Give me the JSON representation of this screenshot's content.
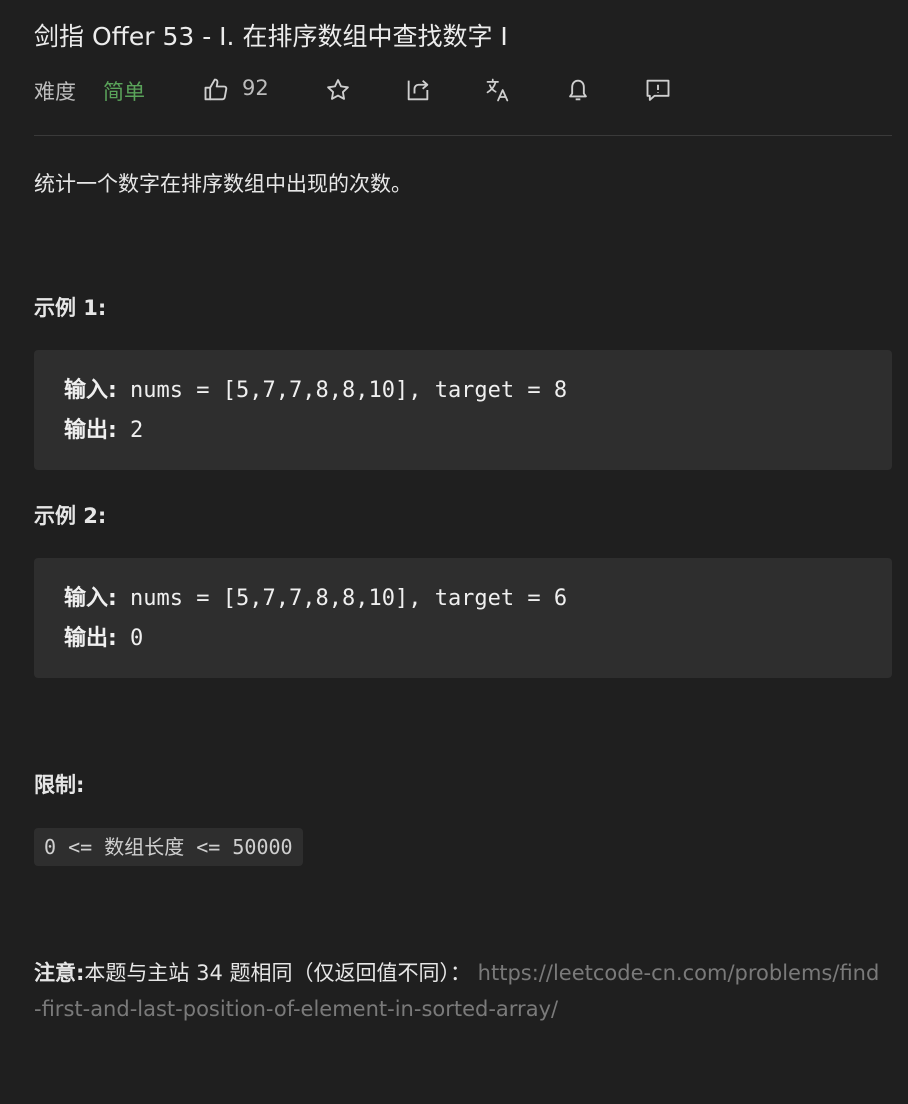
{
  "problem": {
    "title": "剑指 Offer 53 - I. 在排序数组中查找数字 I",
    "difficulty_label": "难度",
    "difficulty": "简单",
    "likes": "92",
    "description": "统计一个数字在排序数组中出现的次数。"
  },
  "toolbar": {
    "icons": [
      "thumbs-up-icon",
      "star-icon",
      "share-icon",
      "translate-icon",
      "bell-icon",
      "feedback-icon"
    ]
  },
  "examples": [
    {
      "title": "示例 1:",
      "input_label": "输入:",
      "input_value": " nums = [5,7,7,8,8,10], target = 8",
      "output_label": "输出:",
      "output_value": " 2"
    },
    {
      "title": "示例 2:",
      "input_label": "输入:",
      "input_value": " nums = [5,7,7,8,8,10], target = 6",
      "output_label": "输出:",
      "output_value": " 0"
    }
  ],
  "constraints": {
    "title": "限制:",
    "code": "0 <= 数组长度 <= 50000"
  },
  "note": {
    "label": "注意:",
    "text": "本题与主站 34 题相同（仅返回值不同）：",
    "link": "https://leetcode-cn.com/problems/find-first-and-last-position-of-element-in-sorted-array/"
  },
  "colors": {
    "background": "#1f1f1f",
    "code_background": "#2e2e2e",
    "difficulty_easy": "#5aa35a",
    "link": "#7a7a7a"
  }
}
